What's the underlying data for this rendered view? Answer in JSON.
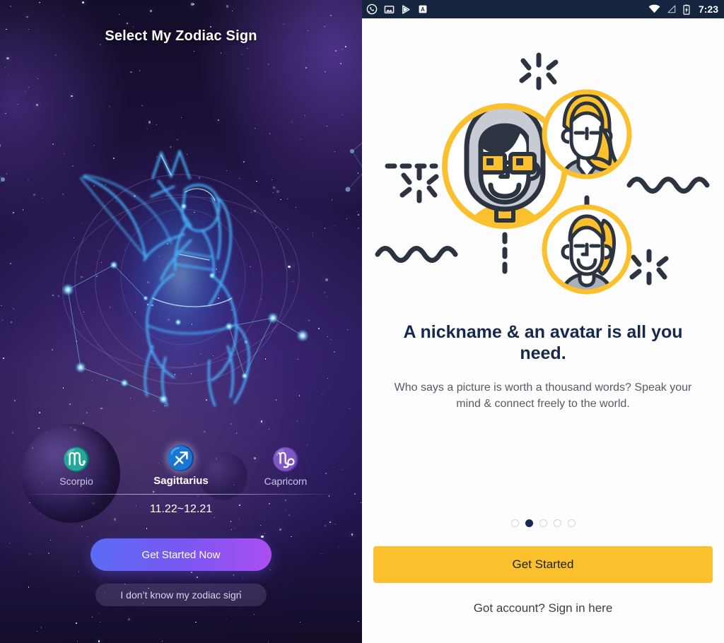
{
  "zodiac_screen": {
    "title": "Select My Zodiac Sign",
    "signs": [
      {
        "name": "Scorpio",
        "glyph": "♏",
        "active": false
      },
      {
        "name": "Sagittarius",
        "glyph": "♐",
        "active": true
      },
      {
        "name": "Capricorn",
        "glyph": "♑",
        "active": false
      }
    ],
    "date_range": "11.22~12.21",
    "primary_button": "Get Started Now",
    "secondary_button": "I don’t know my zodiac sign",
    "illustration": "sagittarius-constellation-archer",
    "colors": {
      "background_top": "#140d28",
      "background_mid": "#2c1c5c",
      "primary_button_from": "#5a6cf3",
      "primary_button_to": "#ab4ef0",
      "active_sign": "#ffffff",
      "inactive_sign": "#6f7ce8"
    }
  },
  "onboarding_screen": {
    "statusbar": {
      "time": "7:23",
      "left_icons": [
        "whatsapp-icon",
        "image-icon",
        "play-store-icon",
        "letter-a-icon"
      ],
      "right_icons": [
        "wifi-icon",
        "signal-icon",
        "battery-charging-icon"
      ],
      "background": "#15253f"
    },
    "illustration": "three-avatar-circles-network",
    "headline": "A nickname & an avatar is all you need.",
    "subtext": "Who says a picture is worth a thousand words? Speak your mind & connect freely to the world.",
    "pagination": {
      "total": 5,
      "active_index": 1
    },
    "primary_button": "Get Started",
    "signin_link": "Got account? Sign in here",
    "colors": {
      "accent": "#fbc02d",
      "headline": "#15284d",
      "body": "#555c66",
      "page": "#fdfdfd"
    }
  }
}
